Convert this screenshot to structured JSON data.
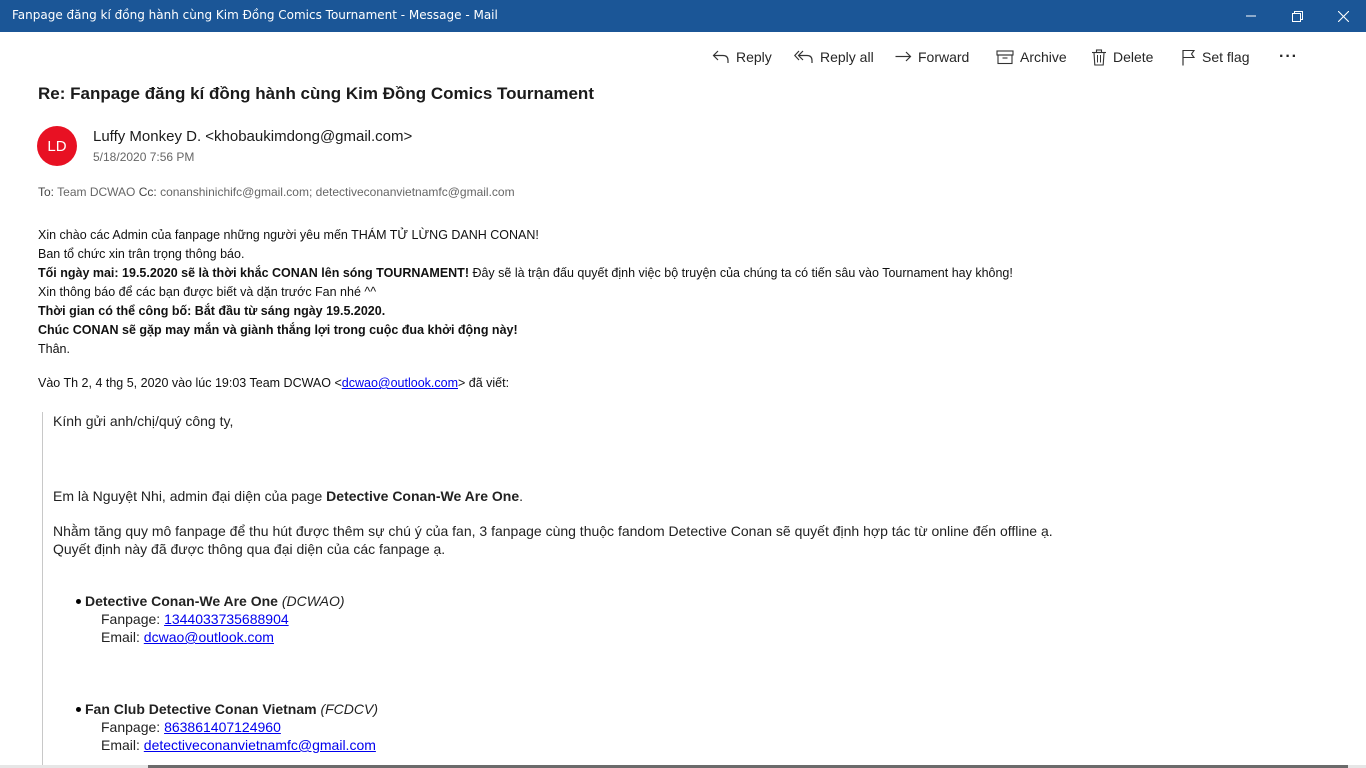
{
  "window": {
    "title": "Fanpage đăng kí đồng hành cùng Kim Đồng Comics Tournament - Message - Mail"
  },
  "toolbar": {
    "reply": "Reply",
    "reply_all": "Reply all",
    "forward": "Forward",
    "archive": "Archive",
    "delete": "Delete",
    "set_flag": "Set flag",
    "more": "···"
  },
  "message": {
    "subject": "Re: Fanpage đăng kí đồng hành cùng Kim Đồng Comics Tournament",
    "avatar_initials": "LD",
    "avatar_color": "#e81123",
    "sender": "Luffy Monkey D. <khobaukimdong@gmail.com>",
    "date": "5/18/2020 7:56 PM",
    "to_label": "To:",
    "to": "Team DCWAO",
    "cc_label": "Cc:",
    "cc": "conanshinichifc@gmail.com; detectiveconanvietnamfc@gmail.com"
  },
  "body": {
    "l1": "Xin chào các Admin của fanpage những người yêu mến THÁM TỬ LỪNG DANH CONAN!",
    "l2": "Ban tổ chức xin trân trọng thông báo.",
    "l3_bold": "Tối ngày mai: 19.5.2020 sẽ là thời khắc CONAN lên sóng TOURNAMENT!",
    "l3_rest": " Đây sẽ là trận đấu quyết định việc bộ truyện của chúng ta có tiến sâu vào Tournament hay không!",
    "l4": "Xin thông báo để các bạn được biết và dặn trước Fan nhé ^^",
    "l5": "Thời gian có thể công bố: Bắt đầu từ sáng ngày 19.5.2020.",
    "l6": "Chúc CONAN sẽ gặp may mắn và giành thắng lợi trong cuộc đua khởi động này!",
    "l7": "Thân."
  },
  "quote_header": {
    "prefix": "Vào Th 2, 4 thg 5, 2020 vào lúc 19:03 Team DCWAO <",
    "email": "dcwao@outlook.com",
    "suffix": "> đã viết:"
  },
  "quoted": {
    "greeting": "Kính gửi anh/chị/quý công ty,",
    "intro_prefix": "Em là Nguyệt Nhi, admin đại diện của page ",
    "intro_bold": "Detective Conan-We Are One",
    "intro_suffix": ".",
    "para1": "Nhằm tăng quy mô fanpage để thu hút được thêm sự chú ý của fan, 3 fanpage cùng thuộc fandom Detective Conan sẽ quyết định hợp tác từ online đến offline ạ.",
    "para2": "Quyết định này đã được thông qua đại diện của các fanpage ạ.",
    "fanpage_label": "Fanpage: ",
    "email_label": "Email: ",
    "pages": [
      {
        "name": "Detective Conan-We Are One",
        "abbr": "(DCWAO)",
        "fanpage_id": "1344033735688904",
        "email": "dcwao@outlook.com"
      },
      {
        "name": "Fan Club Detective Conan Vietnam",
        "abbr": "(FCDCV)",
        "fanpage_id": "863861407124960",
        "email": "detectiveconanvietnamfc@gmail.com"
      }
    ]
  }
}
